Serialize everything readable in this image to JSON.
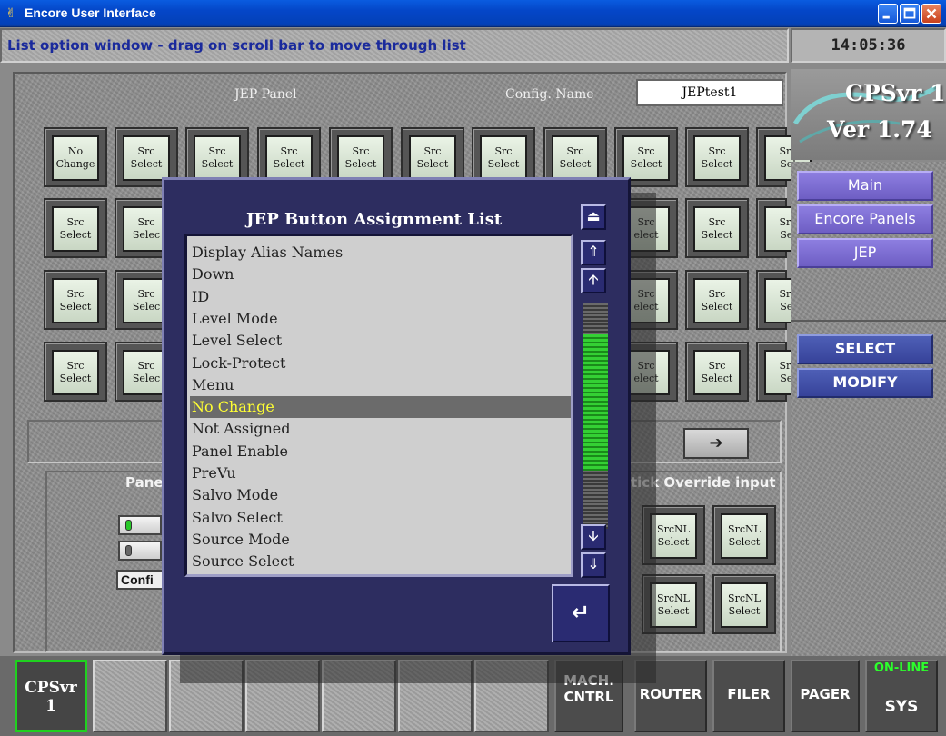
{
  "window": {
    "title": "Encore User Interface"
  },
  "status": {
    "message": "List option window - drag on scroll bar to move through list",
    "clock": "14:05:36"
  },
  "panel": {
    "jep_label": "JEP Panel",
    "config_label": "Config. Name",
    "config_value": "JEPtest1"
  },
  "grid": {
    "row1": [
      "No\nChange",
      "Src\nSelect",
      "Src\nSelect",
      "Src\nSelect",
      "Src\nSelect",
      "Src\nSelect",
      "Src\nSelect",
      "Src\nSelect",
      "Src\nSelect",
      "Src\nSelect",
      "Src\nSel"
    ],
    "row_generic": [
      "Src\nSelect",
      "Src\nSelec",
      "Src\nelect",
      "Src\nSelect",
      "Src\nSel"
    ]
  },
  "lower": {
    "panel_label_partial": "Pane",
    "override_label": "tick Override input",
    "conf_partial": "Confi",
    "srcnl": "SrcNL\nSelect"
  },
  "logo": {
    "line1": "CPSvr 1",
    "line2": "Ver 1.74"
  },
  "nav": {
    "main": "Main",
    "encore_panels": "Encore Panels",
    "jep": "JEP"
  },
  "actions": {
    "select": "SELECT",
    "modify": "MODIFY"
  },
  "bottom": {
    "cpsvr_line1": "CPSvr",
    "cpsvr_line2": "1",
    "mach_line1": "MACH.",
    "mach_line2": "CNTRL",
    "router": "ROUTER",
    "filer": "FILER",
    "pager": "PAGER",
    "online": "ON-LINE",
    "sys": "SYS"
  },
  "dialog": {
    "title": "JEP Button Assignment List",
    "items": [
      "Display Alias Names",
      "Down",
      "ID",
      "Level Mode",
      "Level Select",
      "Lock-Protect",
      "Menu",
      "No Change",
      "Not Assigned",
      "Panel Enable",
      "PreVu",
      "Salvo Mode",
      "Salvo Select",
      "Source Mode",
      "Source Select"
    ],
    "selected_index": 7,
    "scroll_position": 0.55
  }
}
